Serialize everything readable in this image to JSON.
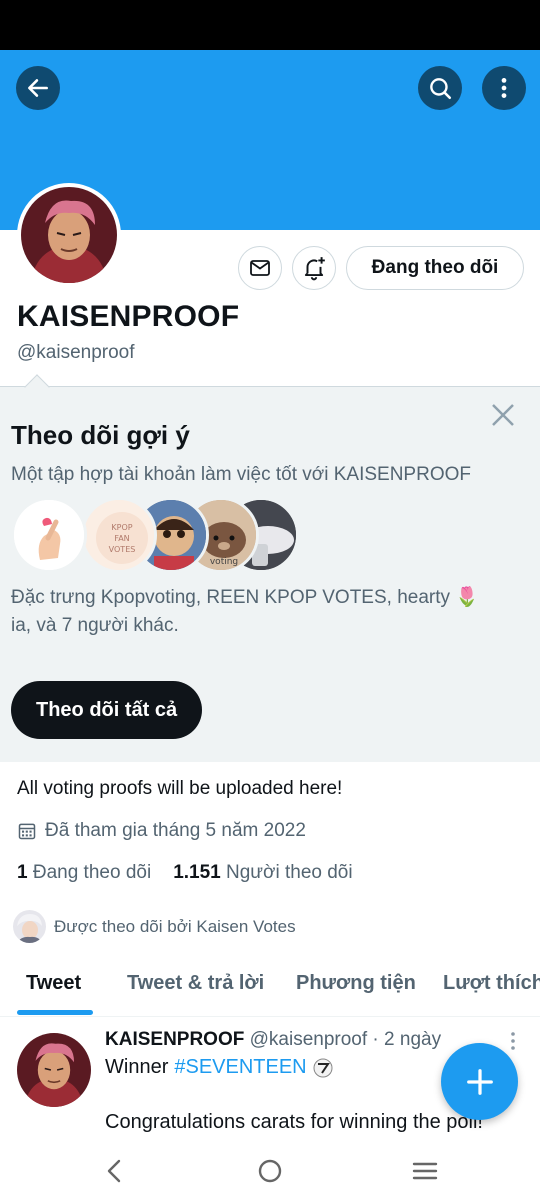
{
  "colors": {
    "accent": "#1d9bf0",
    "banner": "#1d9bf0",
    "text": "#0f1419",
    "muted": "#536471",
    "panel": "#eff3f4"
  },
  "header": {
    "back_icon": "arrow-left-icon",
    "search_icon": "search-icon",
    "more_icon": "more-vertical-icon"
  },
  "profile": {
    "name": "KAISENPROOF",
    "handle": "@kaisenproof",
    "follow_state": "Đang theo dõi",
    "message_icon": "envelope-icon",
    "notify_icon": "bell-plus-icon",
    "bio": "All voting proofs will be uploaded here!",
    "joined": "Đã tham gia tháng 5 năm 2022",
    "following_count": "1",
    "following_label": "Đang theo dõi",
    "followers_count": "1.151",
    "followers_label": "Người theo dõi",
    "followed_by": "Được theo dõi bởi Kaisen Votes"
  },
  "suggestions": {
    "title": "Theo dõi gợi ý",
    "subtitle": "Một tập hợp tài khoản làm việc tốt với KAISENPROOF",
    "avatar_badge_text": "KPOP FAN VOTES",
    "avatar_voting_text": "voting",
    "description_line1": "Đặc trưng Kpopvoting, REEN KPOP VOTES, hearty 🌷",
    "description_line2": "ia, và 7 người khác.",
    "follow_all": "Theo dõi tất cả"
  },
  "tabs": [
    {
      "label": "Tweet",
      "active": true
    },
    {
      "label": "Tweet & trả lời",
      "active": false
    },
    {
      "label": "Phương tiện",
      "active": false
    },
    {
      "label": "Lượt thích",
      "active": false
    }
  ],
  "tweet": {
    "author": "KAISENPROOF",
    "handle_time": "@kaisenproof · 2 ngày",
    "prefix": "Winner",
    "hashtag": "#SEVENTEEN",
    "body": "Congratulations carats for winning the poll!"
  },
  "fab_icon": "plus-icon",
  "navbar": {
    "back": "nav-back-icon",
    "home": "nav-home-icon",
    "recents": "nav-recents-icon"
  }
}
